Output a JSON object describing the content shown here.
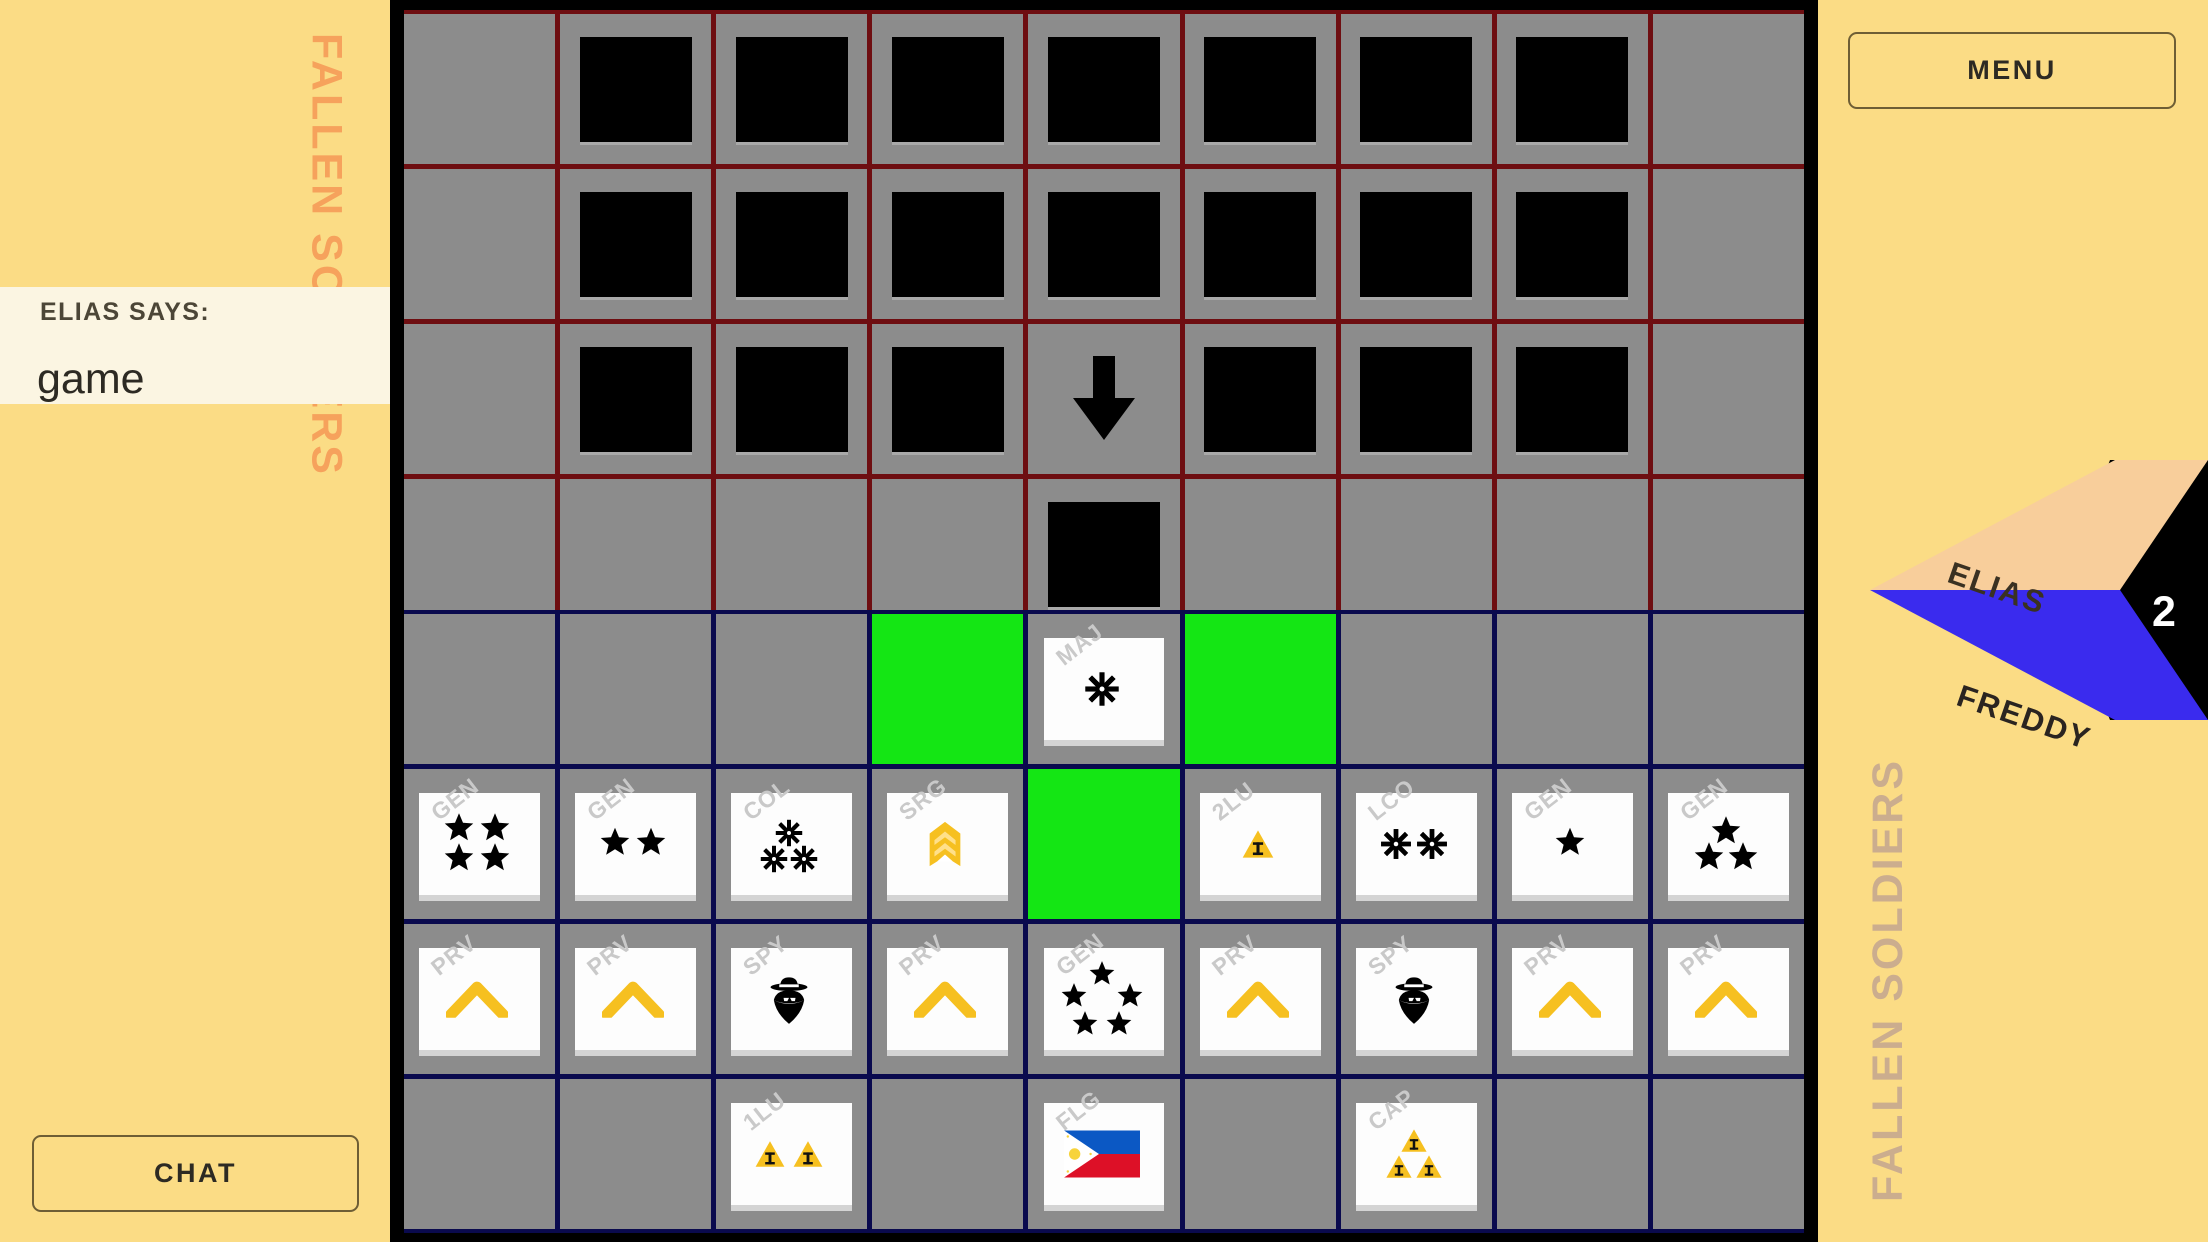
{
  "app": {
    "background_color": "#FBDC85",
    "board_bg": "#000000",
    "enemy_zone_color": "#6E0E11",
    "own_zone_color": "#0A0A4E",
    "highlight_color": "#14E614",
    "accent_orange": "#F6A25C"
  },
  "left_panel": {
    "fallen_soldiers_label": "FALLEN SOLDIERS",
    "chat_says_label": "ELIAS SAYS:",
    "chat_message": "game",
    "chat_button_label": "CHAT"
  },
  "right_panel": {
    "menu_button_label": "MENU",
    "fallen_soldiers_label": "FALLEN SOLDIERS",
    "turn_indicator": {
      "top_player": "ELIAS",
      "bottom_player": "FREDDY",
      "turn_number": "2",
      "top_color": "#F8CE9B",
      "bottom_color": "#3A2BEE",
      "badge_color": "#000000"
    }
  },
  "board": {
    "columns": 9,
    "enemy_rows": 4,
    "own_rows": 4,
    "enemy_grid": [
      [
        "empty",
        "hidden",
        "hidden",
        "hidden",
        "hidden",
        "hidden",
        "hidden",
        "hidden",
        "empty"
      ],
      [
        "empty",
        "hidden",
        "hidden",
        "hidden",
        "hidden",
        "hidden",
        "hidden",
        "hidden",
        "empty"
      ],
      [
        "empty",
        "hidden",
        "hidden",
        "hidden",
        "arrow",
        "hidden",
        "hidden",
        "hidden",
        "empty"
      ],
      [
        "empty",
        "empty",
        "empty",
        "empty",
        "hidden",
        "empty",
        "empty",
        "empty",
        "empty"
      ]
    ],
    "own_grid": [
      [
        {
          "type": "empty"
        },
        {
          "type": "empty"
        },
        {
          "type": "empty"
        },
        {
          "type": "highlight"
        },
        {
          "type": "piece",
          "rank": "MAJ",
          "insignia": "sun",
          "count": 1
        },
        {
          "type": "highlight"
        },
        {
          "type": "empty"
        },
        {
          "type": "empty"
        },
        {
          "type": "empty"
        }
      ],
      [
        {
          "type": "piece",
          "rank": "GEN",
          "insignia": "star",
          "count": 4
        },
        {
          "type": "piece",
          "rank": "GEN",
          "insignia": "star",
          "count": 2
        },
        {
          "type": "piece",
          "rank": "COL",
          "insignia": "sun",
          "count": 3
        },
        {
          "type": "piece",
          "rank": "SRG",
          "insignia": "chevron-badge",
          "count": 1
        },
        {
          "type": "highlight"
        },
        {
          "type": "piece",
          "rank": "2LU",
          "insignia": "triangle-badge",
          "count": 1
        },
        {
          "type": "piece",
          "rank": "LCO",
          "insignia": "sun",
          "count": 2
        },
        {
          "type": "piece",
          "rank": "GEN",
          "insignia": "star",
          "count": 1
        },
        {
          "type": "piece",
          "rank": "GEN",
          "insignia": "star",
          "count": 3
        }
      ],
      [
        {
          "type": "piece",
          "rank": "PRV",
          "insignia": "chevron",
          "count": 1
        },
        {
          "type": "piece",
          "rank": "PRV",
          "insignia": "chevron",
          "count": 1
        },
        {
          "type": "piece",
          "rank": "SPY",
          "insignia": "spy",
          "count": 1
        },
        {
          "type": "piece",
          "rank": "PRV",
          "insignia": "chevron",
          "count": 1
        },
        {
          "type": "piece",
          "rank": "GEN",
          "insignia": "star",
          "count": 5
        },
        {
          "type": "piece",
          "rank": "PRV",
          "insignia": "chevron",
          "count": 1
        },
        {
          "type": "piece",
          "rank": "SPY",
          "insignia": "spy",
          "count": 1
        },
        {
          "type": "piece",
          "rank": "PRV",
          "insignia": "chevron",
          "count": 1
        },
        {
          "type": "piece",
          "rank": "PRV",
          "insignia": "chevron",
          "count": 1
        }
      ],
      [
        {
          "type": "empty"
        },
        {
          "type": "empty"
        },
        {
          "type": "piece",
          "rank": "1LU",
          "insignia": "triangle-badge",
          "count": 2
        },
        {
          "type": "empty"
        },
        {
          "type": "piece",
          "rank": "FLG",
          "insignia": "flag",
          "count": 1
        },
        {
          "type": "empty"
        },
        {
          "type": "piece",
          "rank": "CAP",
          "insignia": "triangle-badge",
          "count": 3
        },
        {
          "type": "empty"
        },
        {
          "type": "empty"
        }
      ]
    ]
  }
}
